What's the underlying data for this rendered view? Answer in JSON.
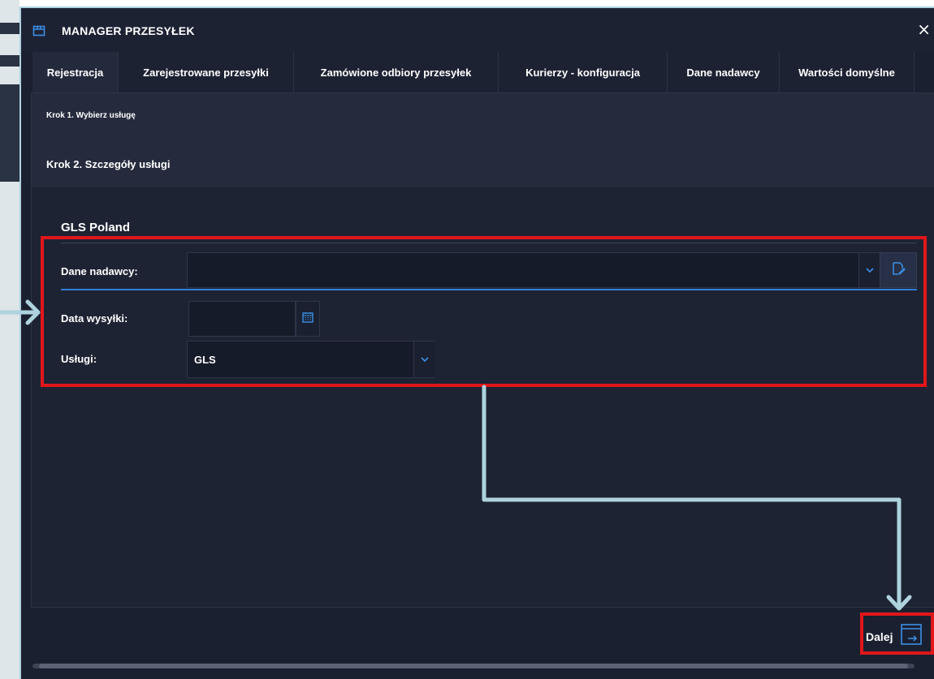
{
  "window": {
    "title": "MANAGER PRZESYŁEK",
    "close_glyph": "×"
  },
  "tabs": [
    {
      "label": "Rejestracja",
      "active": true
    },
    {
      "label": "Zarejestrowane przesyłki",
      "active": false
    },
    {
      "label": "Zamówione odbiory przesyłek",
      "active": false
    },
    {
      "label": "Kurierzy - konfiguracja",
      "active": false
    },
    {
      "label": "Dane nadawcy",
      "active": false
    },
    {
      "label": "Wartości domyślne",
      "active": false
    }
  ],
  "steps": {
    "step1": "Krok 1. Wybierz usługę",
    "step2": "Krok 2. Szczegóły usługi"
  },
  "form": {
    "carrier_title": "GLS Poland",
    "sender_label": "Dane nadawcy:",
    "sender_value": "",
    "date_label": "Data wysyłki:",
    "date_value": "",
    "services_label": "Usługi:",
    "services_value": "GLS"
  },
  "footer": {
    "next_label": "Dalej"
  },
  "icons": {
    "title": "package-icon",
    "calendar": "calendar-icon",
    "edit": "edit-icon",
    "next": "next-arrow-icon",
    "dropdown": "chevron-down-icon"
  },
  "colors": {
    "window_bg": "#1b2030",
    "accent": "#2f7fd6",
    "highlight": "#e0161b",
    "annotation_arrow": "#aed3df"
  }
}
